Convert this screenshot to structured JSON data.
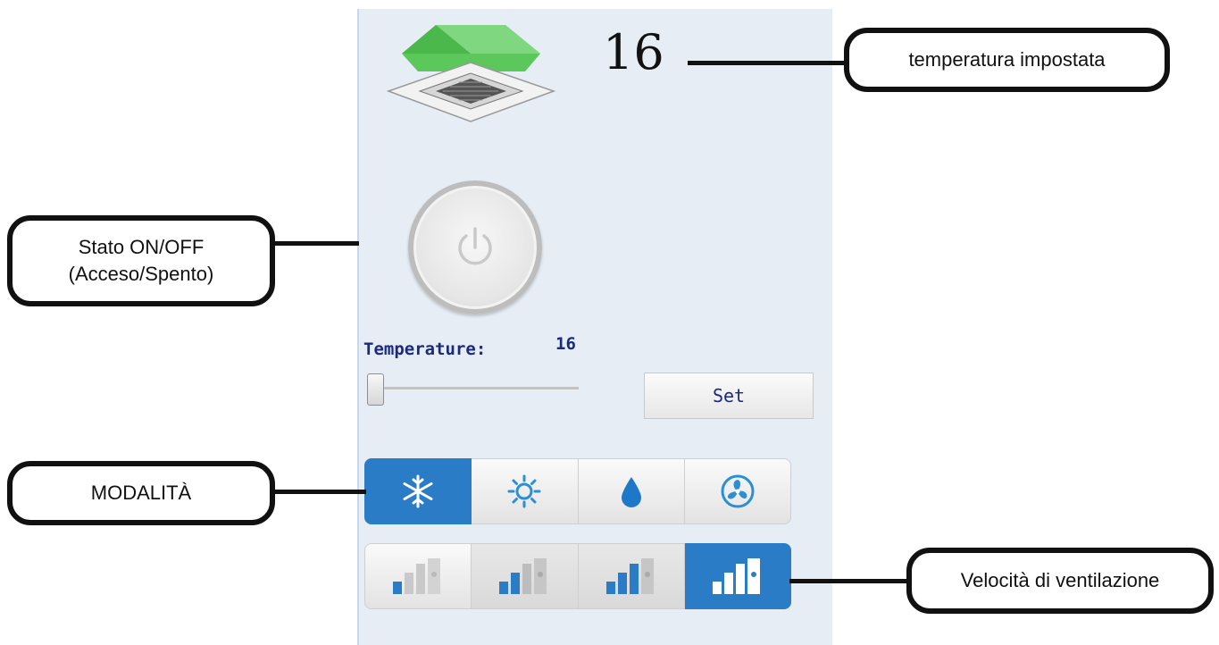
{
  "display": {
    "set_temperature": "16"
  },
  "control": {
    "temperature_label": "Temperature:",
    "temperature_value": "16",
    "slider_level": 0,
    "set_button_label": "Set"
  },
  "modes": {
    "items": [
      "cool-icon",
      "heat-icon",
      "dry-icon",
      "fan-icon"
    ],
    "active": "cool-icon",
    "accent_color": "#2b7cc6"
  },
  "fan_speed": {
    "items": [
      "fan-speed-1-icon",
      "fan-speed-2-icon",
      "fan-speed-3-icon",
      "fan-speed-auto-icon"
    ],
    "active": "fan-speed-auto-icon"
  },
  "callouts": {
    "set_temperature": "temperatura impostata",
    "power_line1": "Stato ON/OFF",
    "power_line2": "(Acceso/Spento)",
    "mode": "MODALITÀ",
    "fan_speed": "Velocità di ventilazione"
  }
}
